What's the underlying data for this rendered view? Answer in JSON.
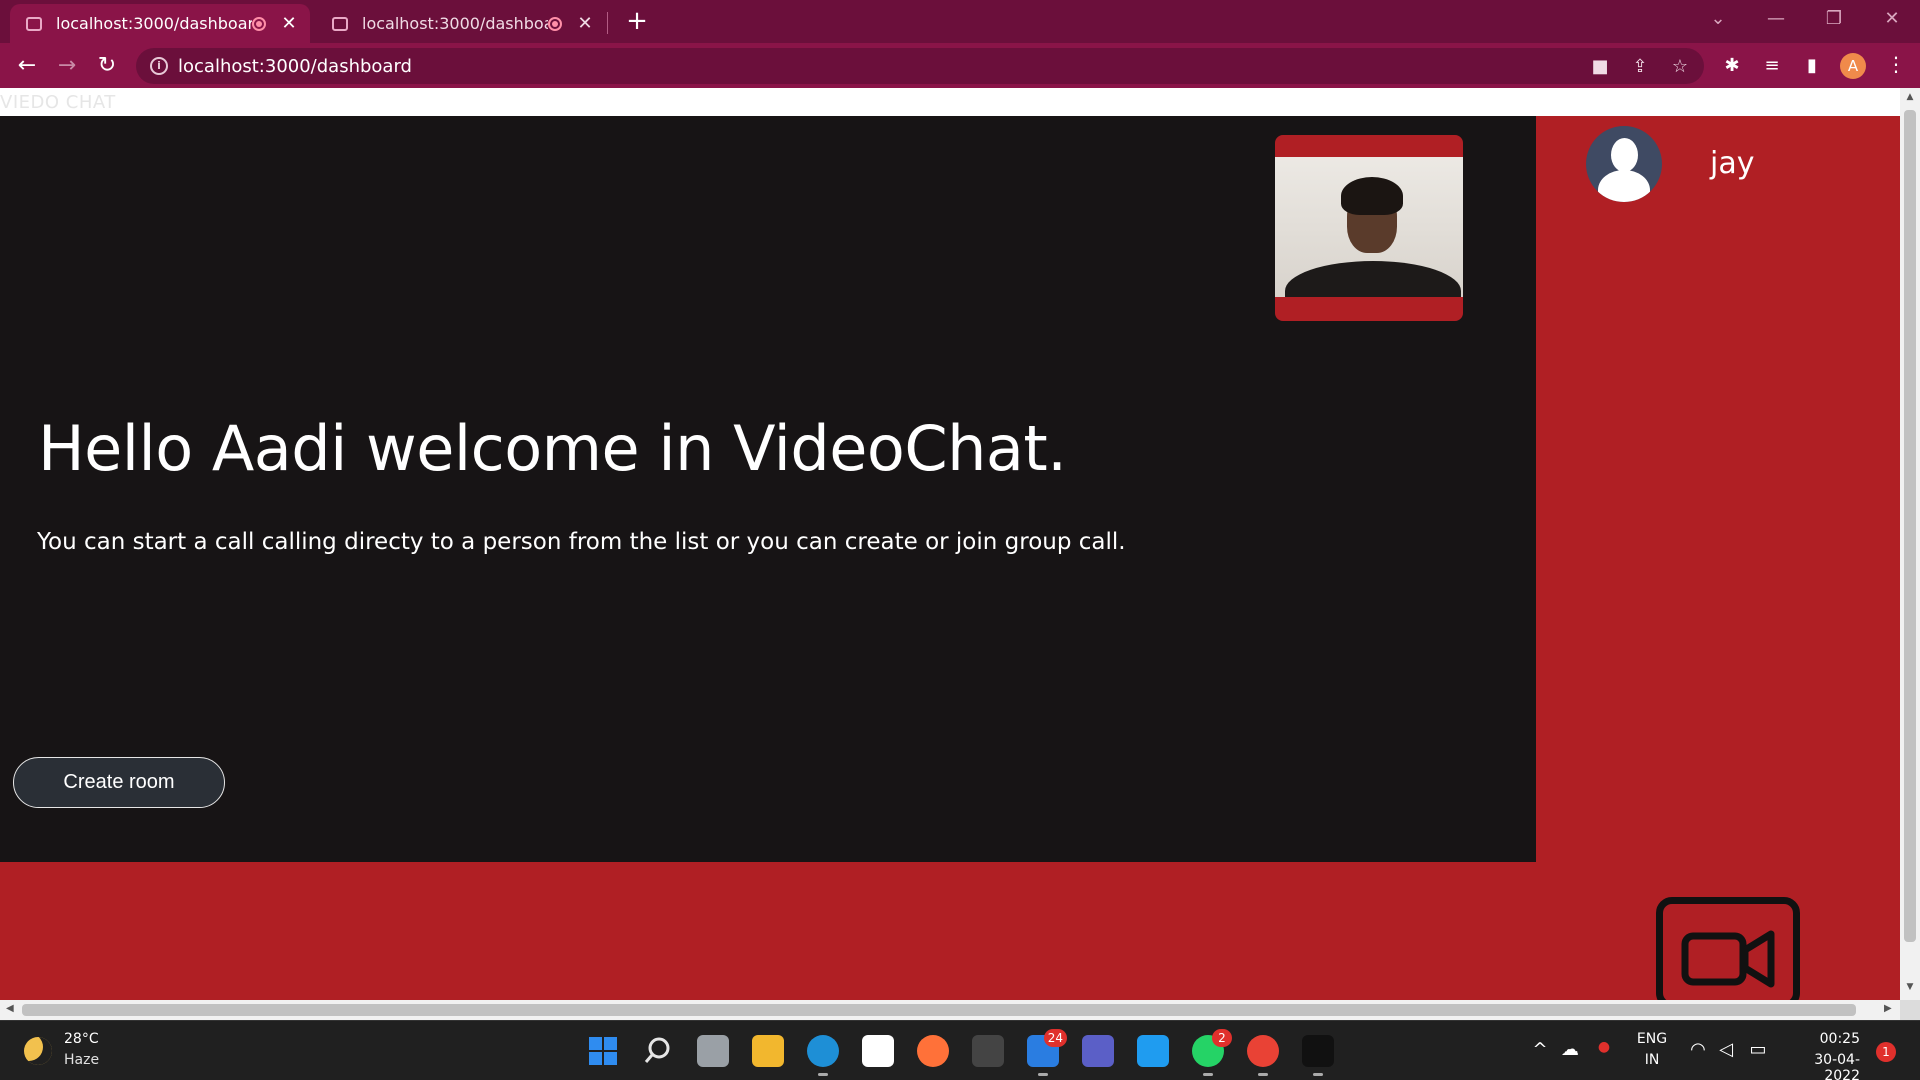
{
  "browser": {
    "tabs": [
      {
        "title": "localhost:3000/dashboard",
        "close": "✕"
      },
      {
        "title": "localhost:3000/dashboard",
        "close": "✕"
      }
    ],
    "new_tab": "+",
    "window_controls": {
      "tablist": "⌄",
      "minimize": "—",
      "restore": "❐",
      "close": "✕"
    },
    "nav": {
      "back": "←",
      "forward": "→",
      "reload": "↻"
    },
    "address": {
      "info": "i",
      "url": "localhost:3000/dashboard"
    },
    "omnibox_icons": {
      "camera": "■",
      "share": "⇪",
      "bookmark": "☆"
    },
    "toolbar_icons": {
      "extensions": "✱",
      "media": "≡",
      "sidebar": "▮",
      "profile": "A",
      "menu": "⋮"
    }
  },
  "page": {
    "brand": "VIEDO CHAT",
    "greeting": "Hello Aadi welcome in VideoChat.",
    "subtitle": "You can start a call calling directy to a person from the list or you can create or join group call.",
    "create_room_label": "Create room",
    "users": [
      {
        "name": "jay"
      }
    ]
  },
  "scrollbars": {
    "up": "▲",
    "down": "▼",
    "left": "◀",
    "right": "▶"
  },
  "taskbar": {
    "weather": {
      "temp": "28°C",
      "condition": "Haze"
    },
    "apps": [
      {
        "name": "start-icon",
        "color": "#2f8cf0"
      },
      {
        "name": "search-icon",
        "color": "#e6e6e6"
      },
      {
        "name": "task-view-icon",
        "color": "#9aa0a6"
      },
      {
        "name": "file-explorer-icon",
        "color": "#f2b72e"
      },
      {
        "name": "edge-icon",
        "color": "#1e8fd6"
      },
      {
        "name": "store-icon",
        "color": "#ffffff"
      },
      {
        "name": "firefox-icon",
        "color": "#ff7139"
      },
      {
        "name": "game-icon",
        "color": "#444444"
      },
      {
        "name": "mail-icon",
        "color": "#2a7de1",
        "badge": "24"
      },
      {
        "name": "teams-icon",
        "color": "#5b5fc7"
      },
      {
        "name": "vscode-icon",
        "color": "#1f9cf0"
      },
      {
        "name": "whatsapp-icon",
        "color": "#25d366",
        "badge": "2"
      },
      {
        "name": "chrome-icon",
        "color": "#e94235"
      },
      {
        "name": "terminal-icon",
        "color": "#111111"
      }
    ],
    "tray": {
      "chevron": "^",
      "onedrive": "☁",
      "mic": "●",
      "wifi": "◠",
      "volume": "◁",
      "battery": "▭"
    },
    "language": {
      "line1": "ENG",
      "line2": "IN"
    },
    "clock": {
      "time": "00:25",
      "date": "30-04-2022"
    },
    "notifications": "1"
  },
  "colors": {
    "tab_bar": "#6b0f3b",
    "toolbar": "#8a1448",
    "app_red": "#b01f24",
    "panel_dark": "#171415",
    "button_dark": "#2a2f36"
  }
}
